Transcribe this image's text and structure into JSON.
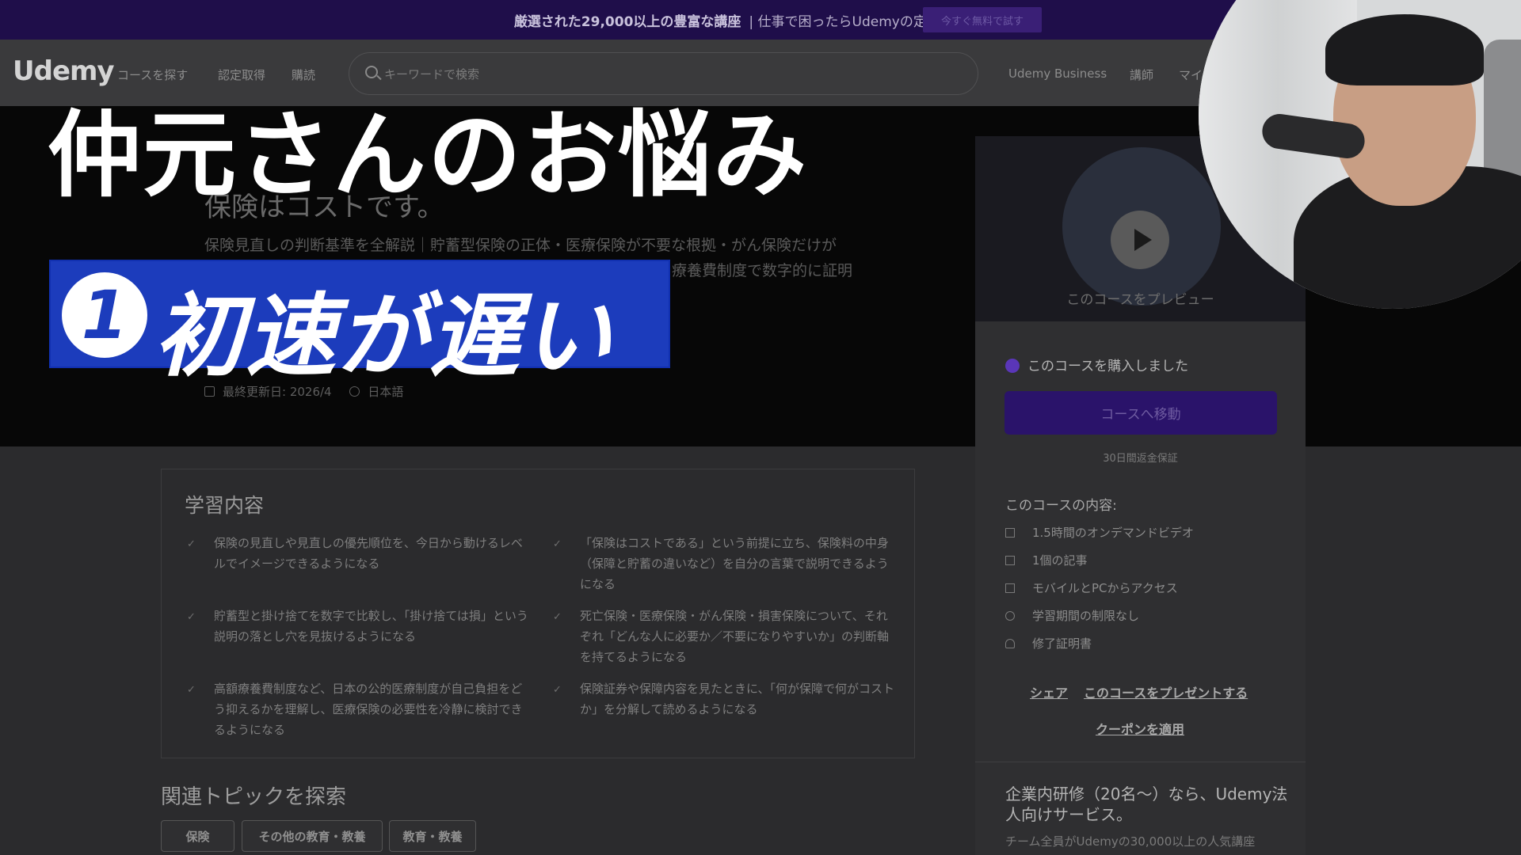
{
  "banner": {
    "bold": "厳選された29,000以上の豊富な講座",
    "text": "| 仕事で困ったらUdemyの定額プランで。",
    "cta": "今すぐ無料で試す"
  },
  "header": {
    "logo": "Udemy",
    "nav": [
      "コースを探す",
      "認定取得",
      "購読"
    ],
    "search_placeholder": "キーワードで検索",
    "right_nav": [
      "Udemy Business",
      "講師",
      "マイ"
    ]
  },
  "hero": {
    "course_title": "保険はコストです。",
    "subtitle": "保険見直しの判断基準を全解説｜貯蓄型保険の正体・医療保険が不要な根拠・がん保険だけが",
    "subtitle_line2": "療養費制度で数字的に証明",
    "last_updated": "最終更新日: 2026/4",
    "language": "日本語"
  },
  "overlay": {
    "title": "仲元さんのお悩み",
    "number": "1",
    "point": "初速が遅い"
  },
  "card": {
    "preview_label": "このコースをプレビュー",
    "purchased": "このコースを購入しました",
    "goto_button": "コースへ移動",
    "guarantee": "30日間返金保証",
    "includes_title": "このコースの内容:",
    "includes": [
      "1.5時間のオンデマンドビデオ",
      "1個の記事",
      "モバイルとPCからアクセス",
      "学習期間の制限なし",
      "修了証明書"
    ],
    "share": "シェア",
    "gift": "このコースをプレゼントする",
    "coupon": "クーポンを適用",
    "biz_title": "企業内研修（20名〜）なら、Udemy法人向けサービス。",
    "biz_sub": "チーム全員がUdemyの30,000以上の人気講座"
  },
  "learn": {
    "title": "学習内容",
    "items": [
      "保険の見直しや見直しの優先順位を、今日から動けるレベルでイメージできるようになる",
      "「保険はコストである」という前提に立ち、保険料の中身（保障と貯蓄の違いなど）を自分の言葉で説明できるようになる",
      "貯蓄型と掛け捨てを数字で比較し、「掛け捨ては損」という説明の落とし穴を見抜けるようになる",
      "死亡保険・医療保険・がん保険・損害保険について、それぞれ「どんな人に必要か／不要になりやすいか」の判断軸を持てるようになる",
      "高額療養費制度など、日本の公的医療制度が自己負担をどう抑えるかを理解し、医療保険の必要性を冷静に検討できるようになる",
      "保険証券や保障内容を見たときに、「何が保障で何がコストか」を分解して読めるようになる"
    ]
  },
  "topics": {
    "title": "関連トピックを探索",
    "tags": [
      "保険",
      "その他の教育・教養",
      "教育・教養"
    ]
  }
}
